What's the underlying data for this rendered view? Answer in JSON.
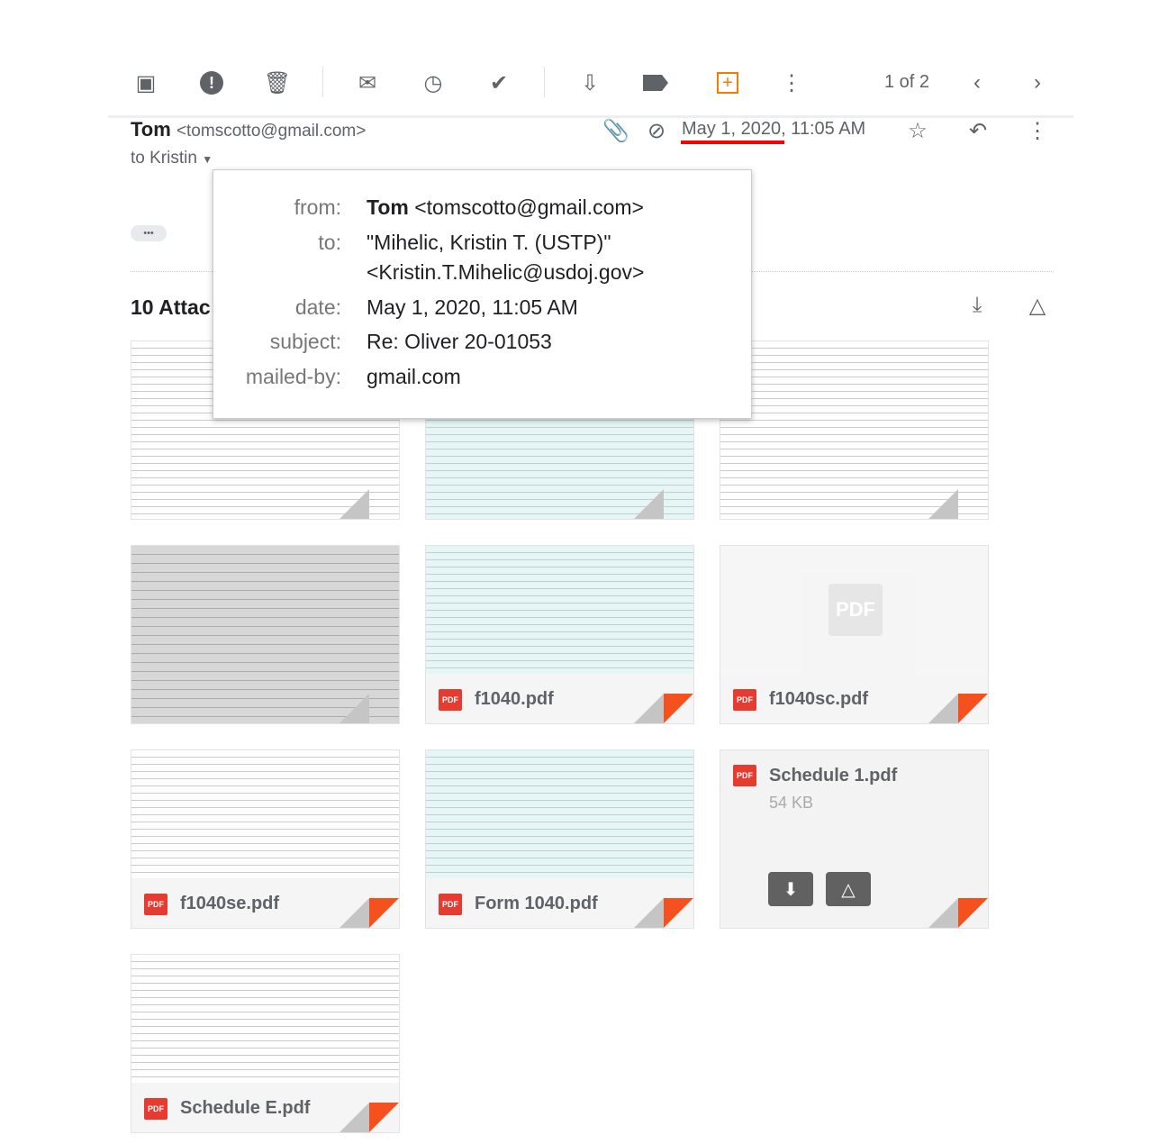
{
  "toolbar": {
    "icons": [
      "archive-icon",
      "report-spam-icon",
      "delete-icon",
      "mark-unread-icon",
      "snooze-icon",
      "add-to-tasks-icon",
      "move-to-icon",
      "label-icon",
      "addon-icon",
      "more-icon"
    ],
    "pagination": "1 of 2"
  },
  "message": {
    "sender_name": "Tom",
    "sender_email": "<tomscotto@gmail.com>",
    "recipient_summary": "to Kristin",
    "date": "May 1, 2020, 11:05 AM",
    "highlight_color": "#ff0000",
    "ellipsis": "•••"
  },
  "details_popup": {
    "from_label": "from:",
    "from_name": "Tom",
    "from_email": "<tomscotto@gmail.com>",
    "to_label": "to:",
    "to_line1": "\"Mihelic, Kristin T. (USTP)\"",
    "to_line2": "<Kristin.T.Mihelic@usdoj.gov>",
    "date_label": "date:",
    "date_value": "May 1, 2020, 11:05 AM",
    "subject_label": "subject:",
    "subject_value": "Re: Oliver 20-01053",
    "mailedby_label": "mailed-by:",
    "mailedby_value": "gmail.com"
  },
  "attachments": {
    "heading": "10 Attac",
    "pdf_badge": "PDF",
    "items": [
      {
        "name": ""
      },
      {
        "name": ""
      },
      {
        "name": ""
      },
      {
        "name": ""
      },
      {
        "name": "f1040.pdf"
      },
      {
        "name": "f1040sc.pdf"
      },
      {
        "name": "f1040se.pdf"
      },
      {
        "name": "Form 1040.pdf"
      },
      {
        "name": "Schedule 1.pdf",
        "size": "54 KB"
      },
      {
        "name": "Schedule E.pdf"
      }
    ],
    "accent_color": "#f4511e"
  }
}
